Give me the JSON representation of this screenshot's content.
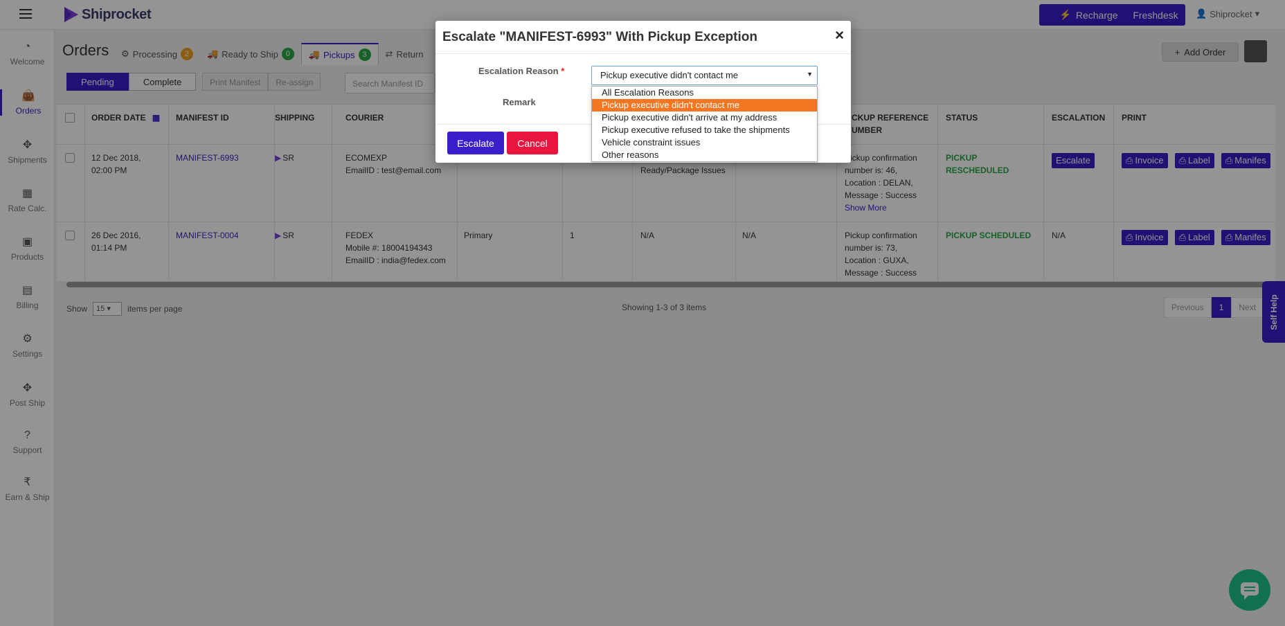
{
  "topbar": {
    "logo_text": "Shiprocket",
    "recharge_label": "Recharge",
    "freshdesk_label": "Freshdesk",
    "user_label": "Shiprocket"
  },
  "sidebar": {
    "items": [
      {
        "label": "Welcome",
        "icon": "gauge-icon"
      },
      {
        "label": "Orders",
        "icon": "bag-icon"
      },
      {
        "label": "Shipments",
        "icon": "shipments-icon"
      },
      {
        "label": "Rate Calc.",
        "icon": "calculator-icon"
      },
      {
        "label": "Products",
        "icon": "grid-icon"
      },
      {
        "label": "Billing",
        "icon": "document-icon"
      },
      {
        "label": "Settings",
        "icon": "gear-icon"
      },
      {
        "label": "Post Ship",
        "icon": "postship-icon"
      },
      {
        "label": "Support",
        "icon": "question-icon"
      },
      {
        "label": "Earn & Ship",
        "icon": "rupee-icon"
      }
    ]
  },
  "page": {
    "title": "Orders",
    "tabs": [
      {
        "label": "Processing",
        "count": "2"
      },
      {
        "label": "Ready to Ship",
        "count": "0"
      },
      {
        "label": "Pickups",
        "count": "3"
      },
      {
        "label": "Return",
        "count": ""
      }
    ],
    "add_order_label": "Add Order",
    "filters": {
      "pending": "Pending",
      "complete": "Complete"
    },
    "actions": {
      "print_manifest": "Print Manifest",
      "re_assign": "Re-assign"
    },
    "search_placeholder": "Search Manifest ID"
  },
  "table": {
    "headers": {
      "order_date": "Order Date",
      "manifest_id": "Manifest ID",
      "shipping": "Shipping",
      "courier": "Courier",
      "pickup_ref_1": "ckup Reference",
      "pickup_ref_2": "umber",
      "status": "Status",
      "escalation": "Escalation",
      "print": "Print"
    },
    "rows": [
      {
        "date_1": "12 Dec 2018,",
        "date_2": "02:00 PM",
        "manifest": "MANIFEST-6993",
        "shipping": "SR",
        "courier_1": "ECOMEXP",
        "courier_2": "EmailID : test@email.com",
        "courier_3": "",
        "warehouse": "",
        "qty": "",
        "issue": "Ready/Package Issues",
        "awb": "",
        "ref_1": "Pickup confirmation",
        "ref_2": "number is: 46,",
        "ref_3": "Location : DELAN,",
        "ref_4": "Message : Success",
        "show_more": "Show More",
        "status": "PICKUP RESCHEDULED",
        "escalation": "Escalate",
        "print": [
          "Invoice",
          "Label",
          "Manifes"
        ]
      },
      {
        "date_1": "26 Dec 2016,",
        "date_2": "01:14 PM",
        "manifest": "MANIFEST-0004",
        "shipping": "SR",
        "courier_1": "FEDEX",
        "courier_2": "Mobile #: 18004194343",
        "courier_3": "EmailID : india@fedex.com",
        "warehouse": "Primary",
        "qty": "1",
        "issue": "N/A",
        "awb": "N/A",
        "ref_1": "Pickup confirmation",
        "ref_2": "number is: 73,",
        "ref_3": "Location : GUXA,",
        "ref_4": "Message : Success",
        "show_more": "",
        "status": "PICKUP SCHEDULED",
        "escalation": "N/A",
        "print": [
          "Invoice",
          "Label",
          "Manifes"
        ]
      }
    ]
  },
  "pagination": {
    "show_label": "Show",
    "per_page_value": "15",
    "items_per_page_label": "items per page",
    "showing_text": "Showing 1-3 of 3 items",
    "previous": "Previous",
    "current_page": "1",
    "next": "Next"
  },
  "self_help_label": "Self Help",
  "modal": {
    "title": "Escalate \"MANIFEST-6993\" With Pickup Exception",
    "close_symbol": "×",
    "escalation_reason_label": "Escalation Reason",
    "required_marker": "*",
    "remark_label": "Remark",
    "selected_reason": "Pickup executive didn't contact me",
    "options": [
      "All Escalation Reasons",
      "Pickup executive didn't contact me",
      "Pickup executive didn't arrive at my address",
      "Pickup executive refused to take the shipments",
      "Vehicle constraint issues",
      "Other reasons"
    ],
    "selected_index": 1,
    "escalate_label": "Escalate",
    "cancel_label": "Cancel"
  },
  "colors": {
    "brand": "#3a1ec9",
    "danger": "#e8163f",
    "highlight": "#f37722",
    "success": "#28a745"
  }
}
